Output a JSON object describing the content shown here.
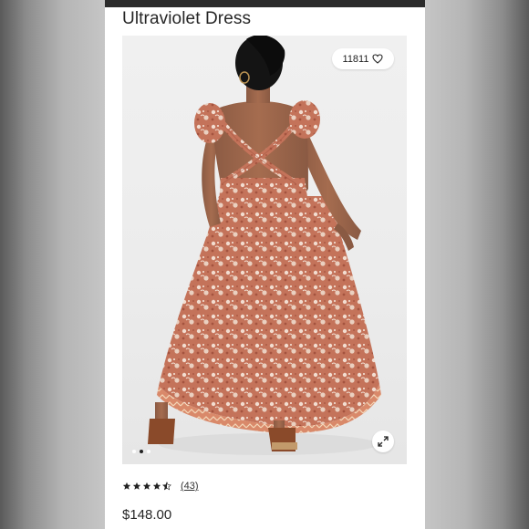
{
  "product": {
    "title": "Ultraviolet Dress",
    "price": "$148.00",
    "rating": 4.5,
    "review_count": "(43)"
  },
  "gallery": {
    "likes": "11811",
    "like_icon": "heart-icon",
    "expand_icon": "expand-icon",
    "image_count": 3,
    "active_image": 2
  },
  "colors": {
    "dress": "#c4735a",
    "text": "#262626",
    "gallery_bg": "#ececec"
  }
}
